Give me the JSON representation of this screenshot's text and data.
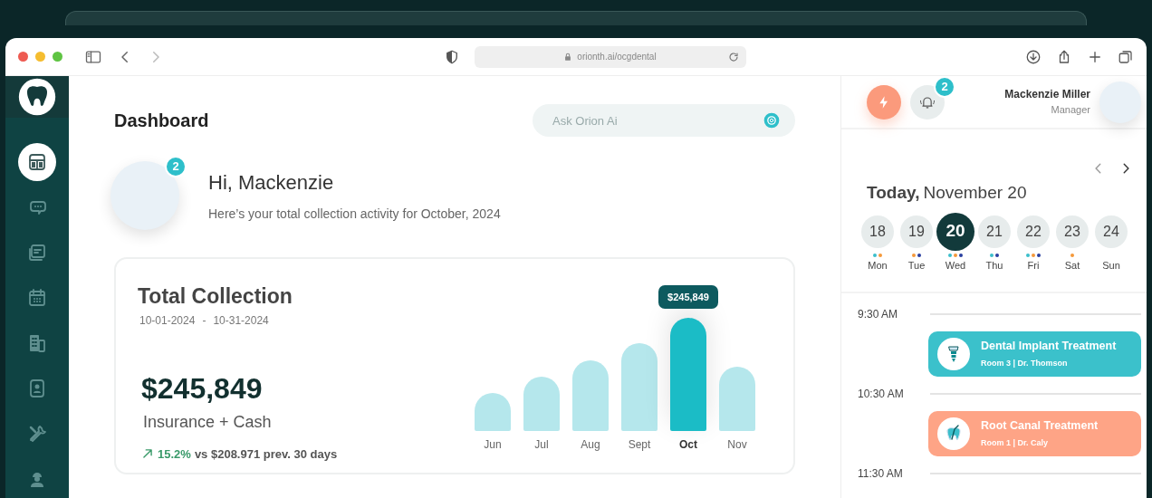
{
  "browser": {
    "url": "orionth.ai/ocgdental"
  },
  "sidebar": {
    "items": [
      {
        "selected": true
      },
      {
        "selected": false
      },
      {
        "selected": false
      },
      {
        "selected": false
      },
      {
        "selected": false
      },
      {
        "selected": false
      },
      {
        "selected": false
      },
      {
        "selected": false
      }
    ]
  },
  "header": {
    "title": "Dashboard",
    "search": {
      "placeholder": "Ask Orion Ai"
    }
  },
  "greeting": {
    "badge": "2",
    "title": "Hi, Mackenzie",
    "subtitle": "Here’s your total collection activity for October, 2024"
  },
  "collection": {
    "title": "Total Collection",
    "date_from": "10-01-2024",
    "separator": "-",
    "date_to": "10-31-2024",
    "amount": "$245,849",
    "amount_label": "Insurance + Cash",
    "change": "15.2%",
    "comparison": "vs $208.971 prev. 30 days",
    "chart": {
      "tooltip": "$245,849",
      "months": [
        {
          "label": "Jun",
          "selected": false
        },
        {
          "label": "Jul",
          "selected": false
        },
        {
          "label": "Aug",
          "selected": false
        },
        {
          "label": "Sept",
          "selected": false
        },
        {
          "label": "Oct",
          "selected": true
        },
        {
          "label": "Nov",
          "selected": false
        }
      ]
    }
  },
  "user": {
    "name": "Mackenzie Miller",
    "role": "Manager",
    "notifications": "2"
  },
  "calendar": {
    "today_label": "Today,",
    "date": "November 20",
    "days": [
      {
        "number": "18",
        "weekday": "Mon",
        "selected": false,
        "dots": [
          {
            "color": "#3bbfcb"
          },
          {
            "color": "#f5993a"
          }
        ]
      },
      {
        "number": "19",
        "weekday": "Tue",
        "selected": false,
        "dots": [
          {
            "color": "#f5993a"
          },
          {
            "color": "#2a3fa0"
          }
        ]
      },
      {
        "number": "20",
        "weekday": "Wed",
        "selected": true,
        "dots": [
          {
            "color": "#3bbfcb"
          },
          {
            "color": "#f5993a"
          },
          {
            "color": "#2a3fa0"
          }
        ]
      },
      {
        "number": "21",
        "weekday": "Thu",
        "selected": false,
        "dots": [
          {
            "color": "#3bbfcb"
          },
          {
            "color": "#2a3fa0"
          }
        ]
      },
      {
        "number": "22",
        "weekday": "Fri",
        "selected": false,
        "dots": [
          {
            "color": "#3bbfcb"
          },
          {
            "color": "#f5993a"
          },
          {
            "color": "#2a3fa0"
          }
        ]
      },
      {
        "number": "23",
        "weekday": "Sat",
        "selected": false,
        "dots": [
          {
            "color": "#f5993a"
          }
        ]
      },
      {
        "number": "24",
        "weekday": "Sun",
        "selected": false
      }
    ]
  },
  "schedule": [
    {
      "time": "9:30 AM",
      "appointment": {
        "kind": "implant",
        "title": "Dental Implant Treatment",
        "details": "Room 3 | Dr. Thomson",
        "color": "#3bc1cb"
      }
    },
    {
      "time": "10:30 AM",
      "appointment": {
        "kind": "root-canal",
        "title": "Root Canal Treatment",
        "details": "Room 1 | Dr. Caly",
        "color": "#fea486"
      }
    },
    {
      "time": "11:30 AM"
    }
  ]
}
